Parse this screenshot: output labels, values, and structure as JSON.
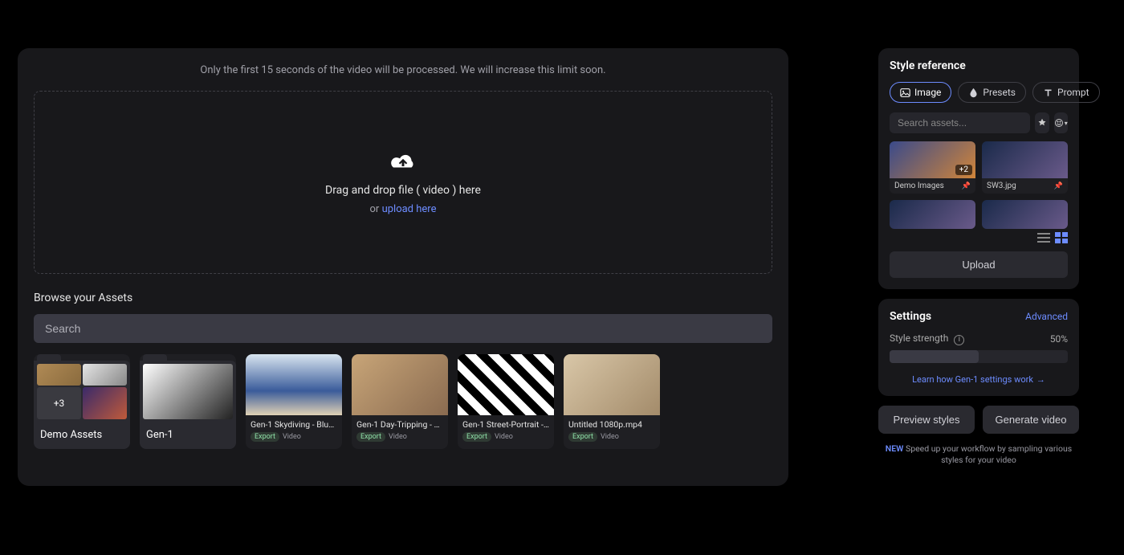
{
  "main": {
    "notice": "Only the first 15 seconds of the video will be processed. We will increase this limit soon.",
    "drop_line1": "Drag and drop file ( video ) here",
    "drop_or": "or ",
    "drop_link": "upload here",
    "browse_title": "Browse your Assets",
    "search_placeholder": "Search",
    "folders": [
      {
        "name": "Demo Assets",
        "extra": "+3"
      },
      {
        "name": "Gen-1",
        "extra": ""
      }
    ],
    "videos": [
      {
        "title": "Gen-1 Skydiving - Blue ...",
        "badge": "Export",
        "type": "Video",
        "thumb": "g3"
      },
      {
        "title": "Gen-1 Day-Tripping - W...",
        "badge": "Export",
        "type": "Video",
        "thumb": "g4"
      },
      {
        "title": "Gen-1 Street-Portrait - ...",
        "badge": "Export",
        "type": "Video",
        "thumb": "g5"
      },
      {
        "title": "Untitled 1080p.mp4",
        "badge": "Export",
        "type": "Video",
        "thumb": "g6"
      }
    ]
  },
  "style": {
    "title": "Style reference",
    "tabs": [
      {
        "label": "Image",
        "icon": "image-icon",
        "active": true
      },
      {
        "label": "Presets",
        "icon": "droplet-icon",
        "active": false
      },
      {
        "label": "Prompt",
        "icon": "text-icon",
        "active": false
      }
    ],
    "search_placeholder": "Search assets...",
    "refs": [
      {
        "label": "Demo Images",
        "badge": "+2",
        "thumb": "gblue"
      },
      {
        "label": "SW3.jpg",
        "badge": "",
        "thumb": "g8"
      }
    ],
    "upload_label": "Upload"
  },
  "settings": {
    "title": "Settings",
    "advanced": "Advanced",
    "strength_label": "Style strength",
    "strength_value": "50%",
    "learn_link": "Learn how Gen-1 settings work"
  },
  "actions": {
    "preview": "Preview styles",
    "generate": "Generate video"
  },
  "tip": {
    "new": "NEW",
    "text": " Speed up your workflow by sampling various styles for your video"
  }
}
